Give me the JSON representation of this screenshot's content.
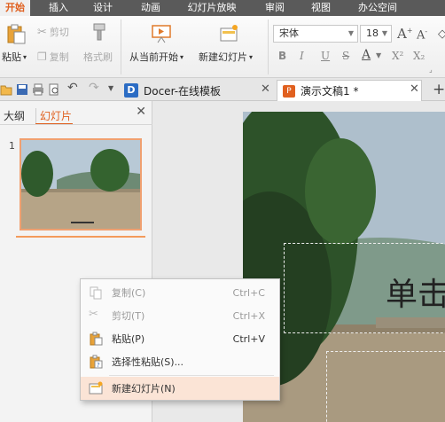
{
  "menu": {
    "tabs": [
      "开始",
      "插入",
      "设计",
      "动画",
      "幻灯片放映",
      "审阅",
      "视图",
      "办公空间"
    ],
    "active_index": 0
  },
  "ribbon": {
    "paste_label": "粘贴",
    "cut_label": "剪切",
    "copy_label": "复制",
    "format_painter_label": "格式刷",
    "from_current_label": "从当前开始",
    "new_slide_label": "新建幻灯片",
    "font_name": "宋体",
    "font_size": "18",
    "bold": "B",
    "italic": "I",
    "underline": "U",
    "strike": "S",
    "font_color": "A",
    "superscript": "X²",
    "subscript": "X₂"
  },
  "tabs": {
    "docer_label": "Docer-在线模板",
    "doc_label": "演示文稿1 *"
  },
  "pane": {
    "outline_label": "大纲",
    "slides_label": "幻灯片",
    "slide_number": "1"
  },
  "slide": {
    "title_fragment": "单击"
  },
  "context_menu": {
    "items": [
      {
        "label": "复制(C)",
        "shortcut": "Ctrl+C",
        "icon": "copy-icon",
        "enabled": false
      },
      {
        "label": "剪切(T)",
        "shortcut": "Ctrl+X",
        "icon": "cut-icon",
        "enabled": false
      },
      {
        "label": "粘贴(P)",
        "shortcut": "Ctrl+V",
        "icon": "paste-icon",
        "enabled": true
      },
      {
        "label": "选择性粘贴(S)...",
        "shortcut": "",
        "icon": "paste-special-icon",
        "enabled": true
      },
      {
        "label": "新建幻灯片(N)",
        "shortcut": "",
        "icon": "new-slide-icon",
        "enabled": true
      }
    ]
  },
  "colors": {
    "accent": "#e0601f",
    "menubar": "#5a5a5a",
    "highlight": "#fbe4d6"
  }
}
